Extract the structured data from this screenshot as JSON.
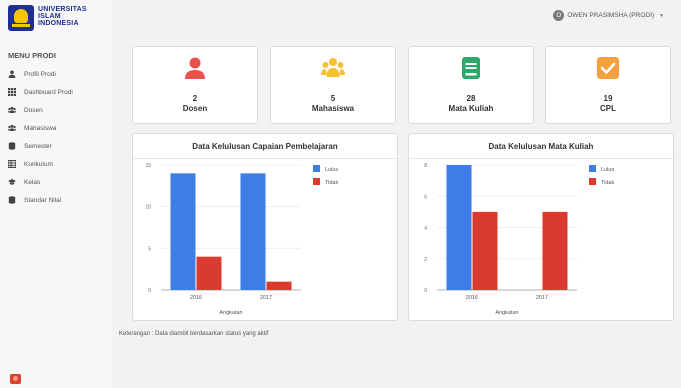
{
  "logo": {
    "line1": "UNIVERSITAS",
    "line2": "ISLAM",
    "line3": "INDONESIA"
  },
  "user": {
    "initial": "O",
    "name": "OWEN PRASIMSHA (PRODI)"
  },
  "menu": {
    "title": "MENU PRODI",
    "items": [
      {
        "label": "Profil Prodi",
        "icon": "user-icon"
      },
      {
        "label": "Dashboard Prodi",
        "icon": "grid-icon"
      },
      {
        "label": "Dosen",
        "icon": "users-icon"
      },
      {
        "label": "Mahasiswa",
        "icon": "users-icon"
      },
      {
        "label": "Semester",
        "icon": "database-icon"
      },
      {
        "label": "Kurikulum",
        "icon": "table-icon"
      },
      {
        "label": "Kelas",
        "icon": "graduation-cap-icon"
      },
      {
        "label": "Standar Nilai",
        "icon": "database-icon"
      }
    ]
  },
  "stats": [
    {
      "value": "2",
      "label": "Dosen",
      "color": "#e8524a",
      "icon": "person-icon"
    },
    {
      "value": "5",
      "label": "Mahasiswa",
      "color": "#f5c231",
      "icon": "group-icon"
    },
    {
      "value": "28",
      "label": "Mata Kuliah",
      "color": "#2ea86a",
      "icon": "book-icon"
    },
    {
      "value": "19",
      "label": "CPL",
      "color": "#f5a142",
      "icon": "check-square-icon"
    }
  ],
  "chart_data": [
    {
      "type": "bar",
      "title": "Data Kelulusan Capaian Pembelajaran",
      "xlabel": "Angkatan",
      "ylabel": "",
      "categories": [
        "2016",
        "2017"
      ],
      "ylim": [
        0,
        15
      ],
      "yticks": [
        0,
        5,
        10,
        15
      ],
      "legend_position": "top-right",
      "series": [
        {
          "name": "Lulus",
          "color": "#3d7ee6",
          "values": [
            14,
            14
          ]
        },
        {
          "name": "Tidak",
          "color": "#db3b2e",
          "values": [
            4,
            1
          ]
        }
      ]
    },
    {
      "type": "bar",
      "title": "Data Kelulusan Mata Kuliah",
      "xlabel": "Angkatan",
      "ylabel": "",
      "categories": [
        "2016",
        "2017"
      ],
      "ylim": [
        0,
        8
      ],
      "yticks": [
        0,
        2,
        4,
        6,
        8
      ],
      "legend_position": "top-right",
      "series": [
        {
          "name": "Lulus",
          "color": "#3d7ee6",
          "values": [
            8,
            0
          ]
        },
        {
          "name": "Tidak",
          "color": "#db3b2e",
          "values": [
            5,
            5
          ]
        }
      ]
    }
  ],
  "note": "Keterangan : Data diambil berdasarkan status yang aktif"
}
